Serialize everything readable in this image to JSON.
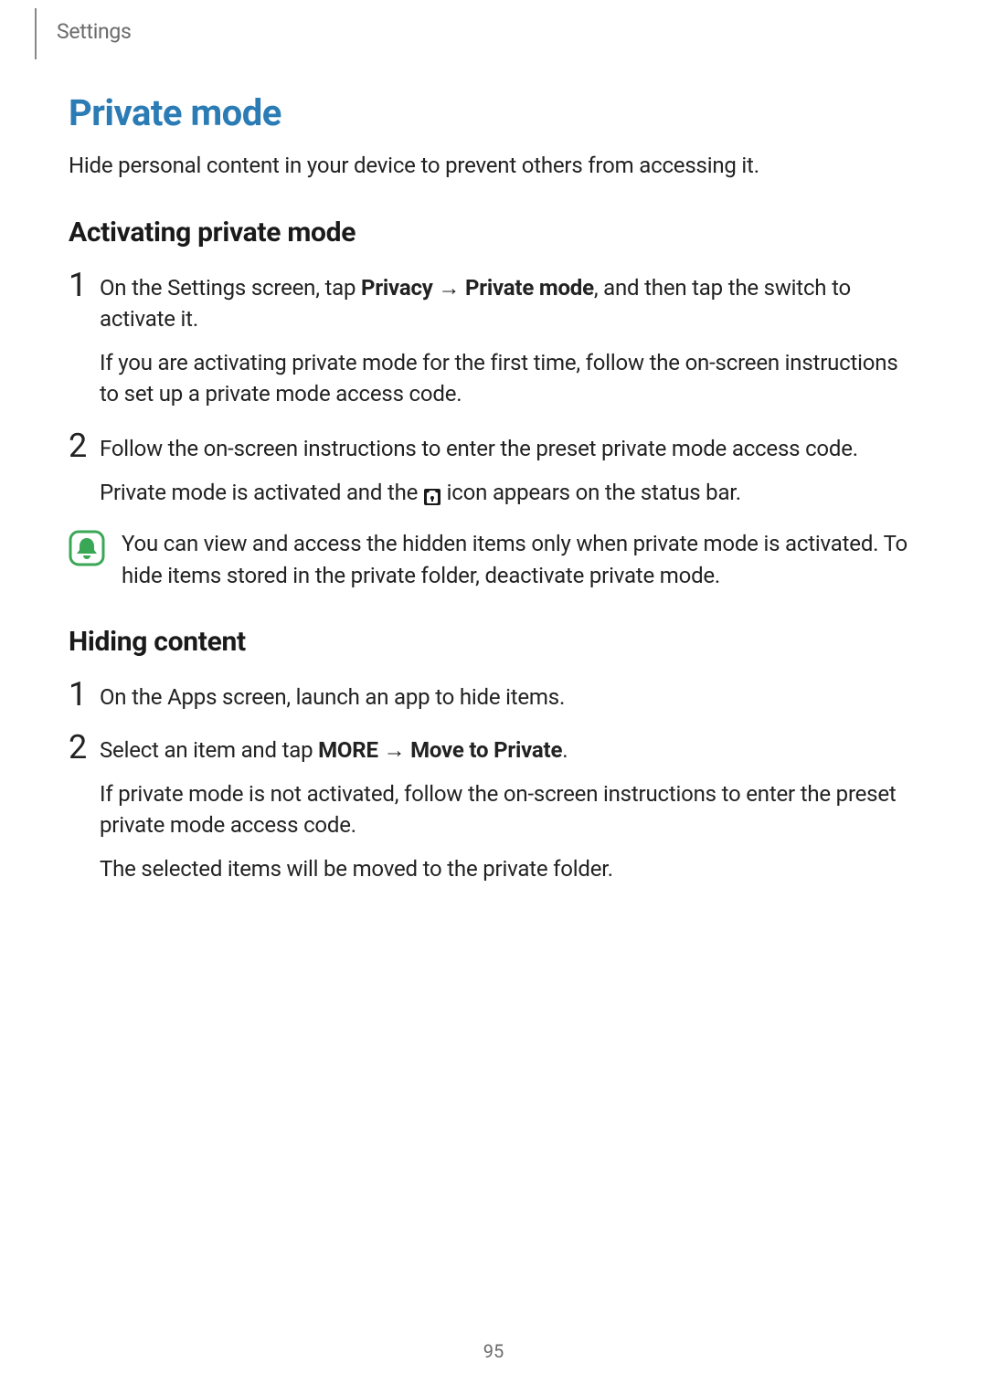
{
  "header": {
    "breadcrumb": "Settings"
  },
  "title": "Private mode",
  "intro": "Hide personal content in your device to prevent others from accessing it.",
  "section1": {
    "heading": "Activating private mode",
    "step1": {
      "num": "1",
      "line_a_pre": "On the Settings screen, tap ",
      "line_a_b1": "Privacy",
      "line_a_arrow": " → ",
      "line_a_b2": "Private mode",
      "line_a_post": ", and then tap the switch to activate it.",
      "line_b": "If you are activating private mode for the first time, follow the on-screen instructions to set up a private mode access code."
    },
    "step2": {
      "num": "2",
      "line_a": "Follow the on-screen instructions to enter the preset private mode access code.",
      "line_b_pre": "Private mode is activated and the ",
      "line_b_post": " icon appears on the status bar."
    },
    "note": "You can view and access the hidden items only when private mode is activated. To hide items stored in the private folder, deactivate private mode."
  },
  "section2": {
    "heading": "Hiding content",
    "step1": {
      "num": "1",
      "line_a": "On the Apps screen, launch an app to hide items."
    },
    "step2": {
      "num": "2",
      "line_a_pre": "Select an item and tap ",
      "line_a_b1": "MORE",
      "line_a_arrow": " → ",
      "line_a_b2": "Move to Private",
      "line_a_post": ".",
      "line_b": "If private mode is not activated, follow the on-screen instructions to enter the preset private mode access code.",
      "line_c": "The selected items will be moved to the private folder."
    }
  },
  "page_number": "95"
}
